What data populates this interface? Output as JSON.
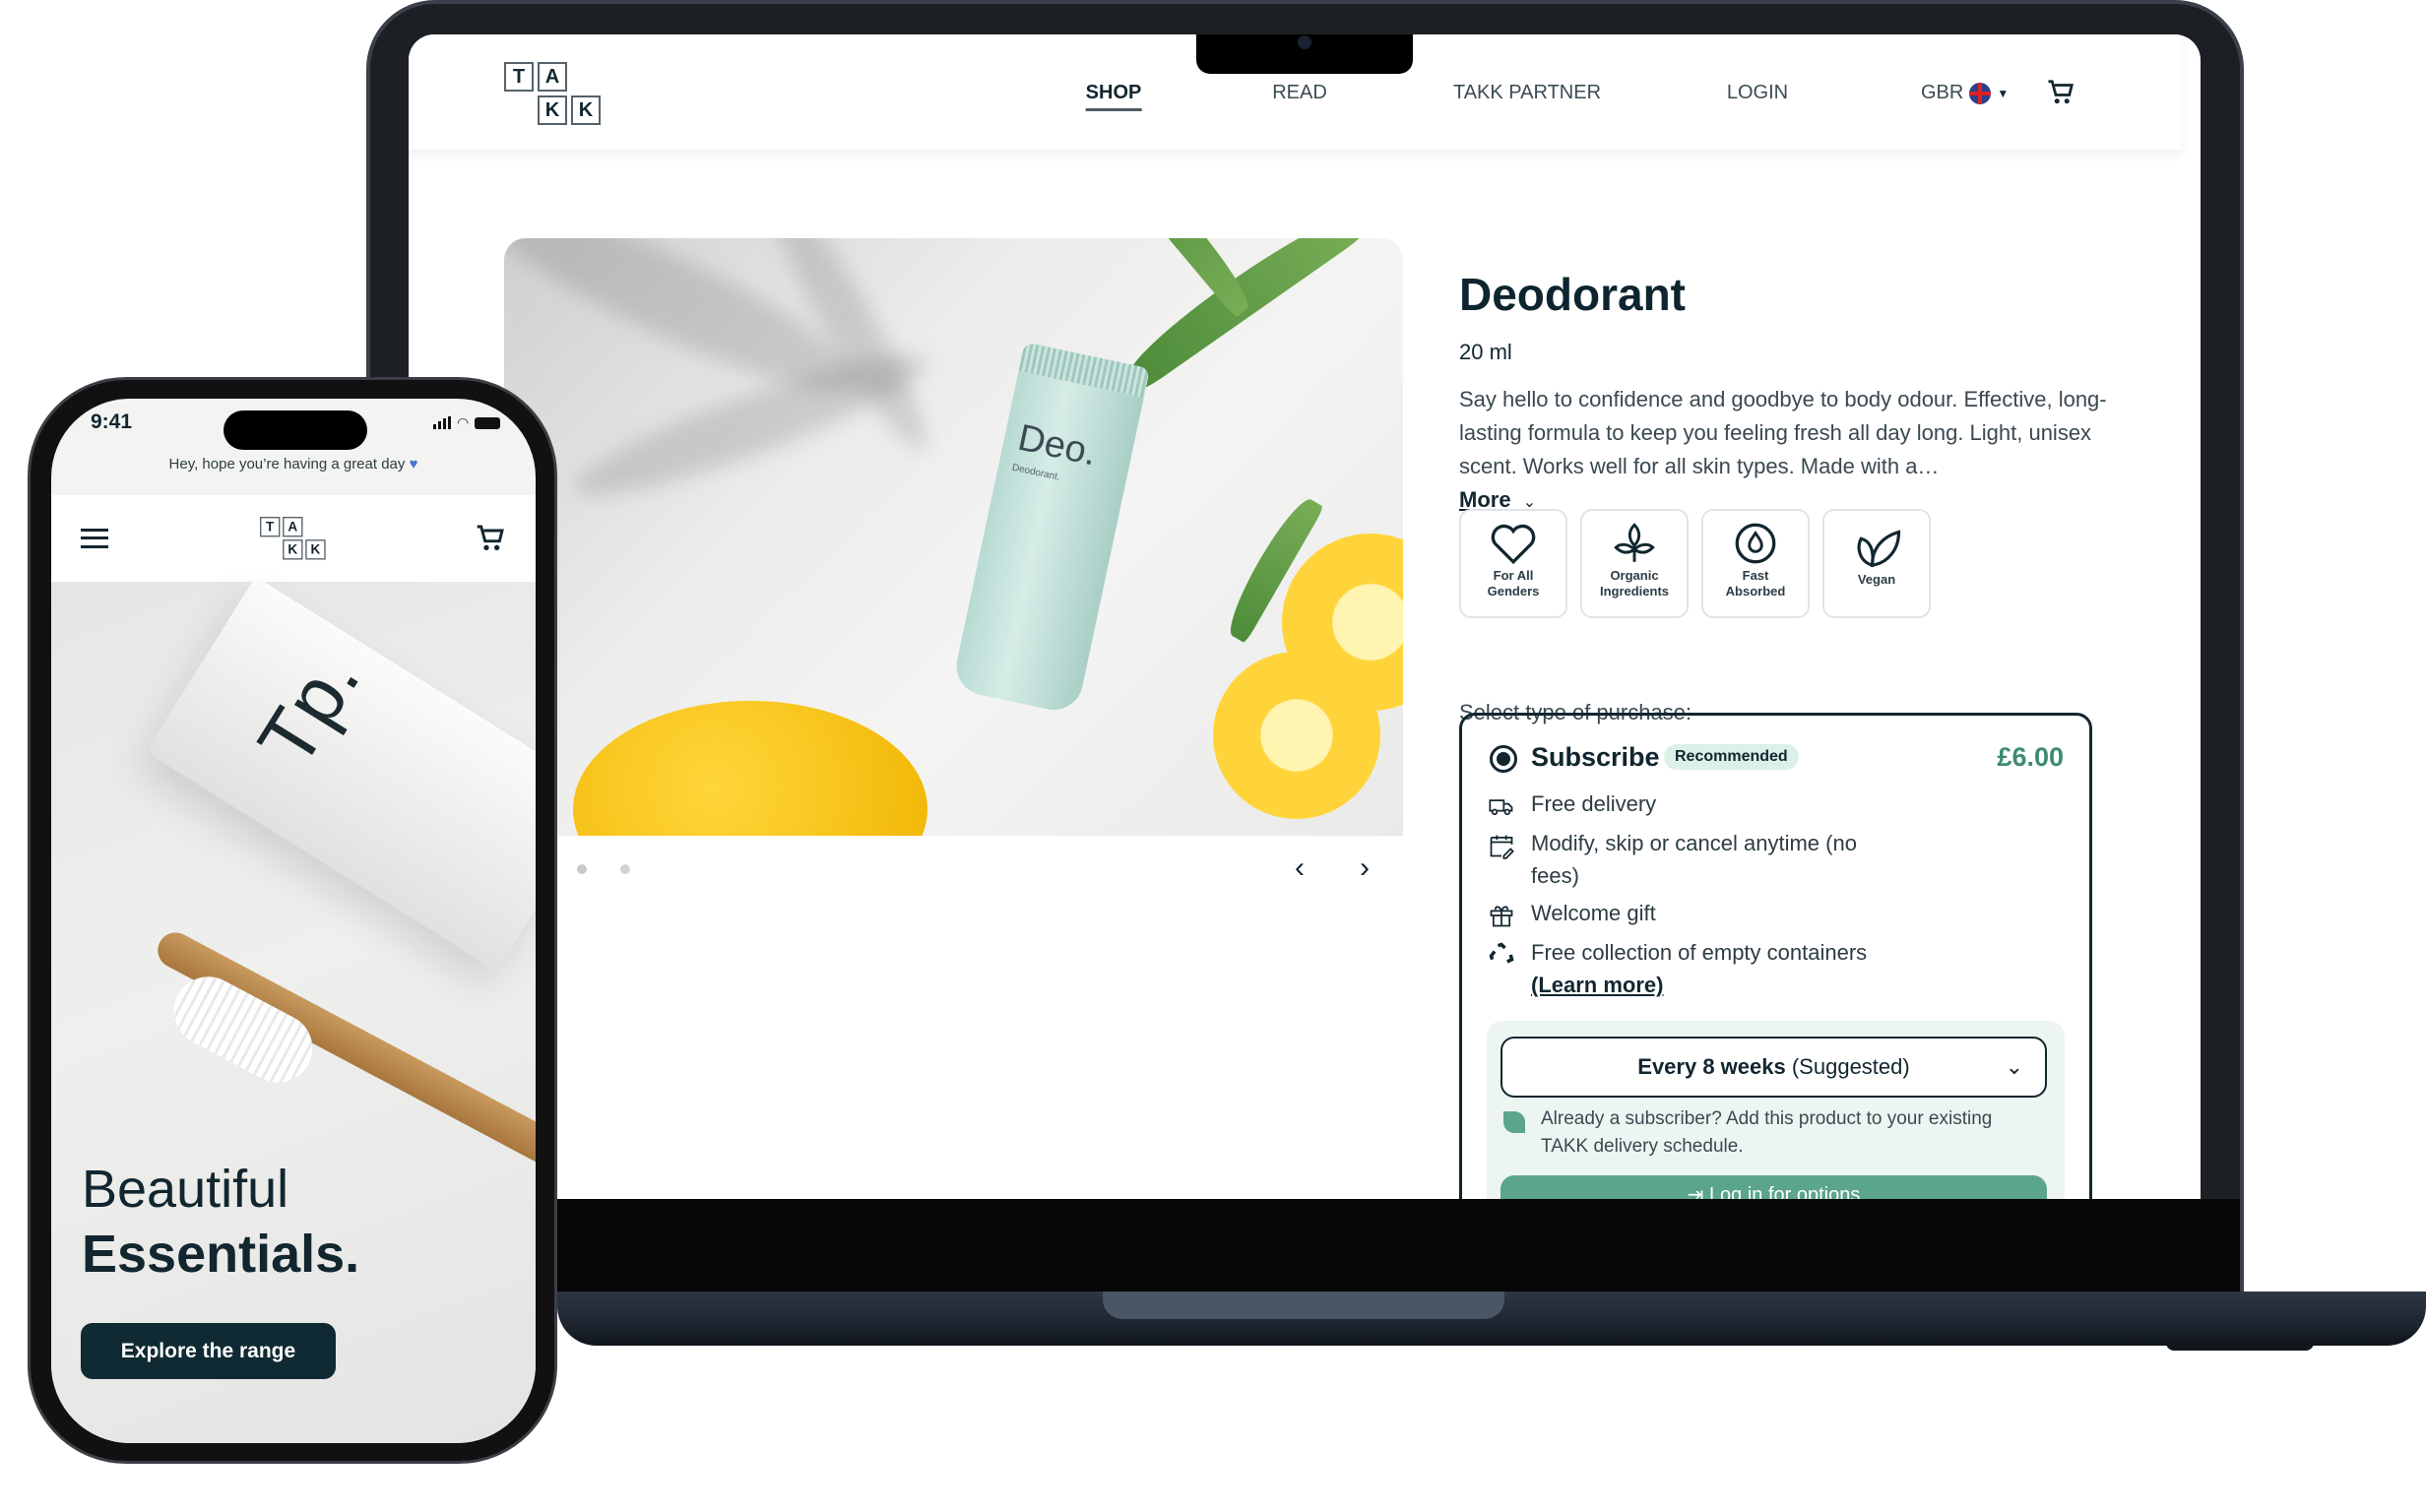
{
  "laptop": {
    "header": {
      "logo_letters": [
        "T",
        "A",
        "K",
        "K"
      ],
      "nav": [
        {
          "label": "SHOP",
          "active": true
        },
        {
          "label": "READ",
          "active": false
        },
        {
          "label": "TAKK PARTNER",
          "active": false
        },
        {
          "label": "LOGIN",
          "active": false
        }
      ],
      "region": "GBR",
      "region_icon": "uk-flag-icon",
      "cart_icon": "cart-icon"
    },
    "gallery": {
      "image_label": "Deo.",
      "image_sublabel": "Deodorant.",
      "slides": 2,
      "current_slide": 1,
      "prev_icon": "chevron-left-icon",
      "next_icon": "chevron-right-icon"
    },
    "product": {
      "title": "Deodorant",
      "size": "20 ml",
      "description": "Say hello to confidence and goodbye to body odour. Effective, long-lasting formula to keep you feeling fresh all day long. Light, unisex scent. Works well for all skin types. Made with a…",
      "more_label": "More",
      "badges": [
        {
          "icon": "heart-icon",
          "label": "For All Genders"
        },
        {
          "icon": "sprout-icon",
          "label": "Organic Ingredients"
        },
        {
          "icon": "droplet-cycle-icon",
          "label": "Fast Absorbed"
        },
        {
          "icon": "leaves-icon",
          "label": "Vegan"
        }
      ],
      "purchase_label": "Select type of purchase:",
      "subscribe": {
        "label": "Subscribe",
        "tag": "Recommended",
        "price": "£6.00",
        "selected": true,
        "features": [
          {
            "icon": "truck-icon",
            "text": "Free delivery"
          },
          {
            "icon": "calendar-edit-icon",
            "text": "Modify, skip or cancel anytime (no fees)"
          },
          {
            "icon": "gift-icon",
            "text": "Welcome gift"
          },
          {
            "icon": "recycle-icon",
            "text": "Free collection of empty containers"
          }
        ],
        "learn_more": "(Learn more)",
        "frequency_bold": "Every 8 weeks",
        "frequency_note": "(Suggested)",
        "subscriber_note": "Already a subscriber? Add this product to your existing TAKK delivery schedule.",
        "login_button": "Log in for options"
      }
    }
  },
  "phone": {
    "time": "9:41",
    "greeting": "Hey, hope you’re having a great day",
    "greeting_icon": "blue-heart-icon",
    "logo_letters": [
      "T",
      "A",
      "K",
      "K"
    ],
    "hero_product_label": "Tp.",
    "headline_line1": "Beautiful",
    "headline_line2": "Essentials.",
    "cta": "Explore the range"
  },
  "colors": {
    "dark": "#12262f",
    "green": "#3e8b70",
    "mint": "#dcefe8",
    "button_green": "#5aa58b",
    "heart_blue": "#4a72d0"
  }
}
